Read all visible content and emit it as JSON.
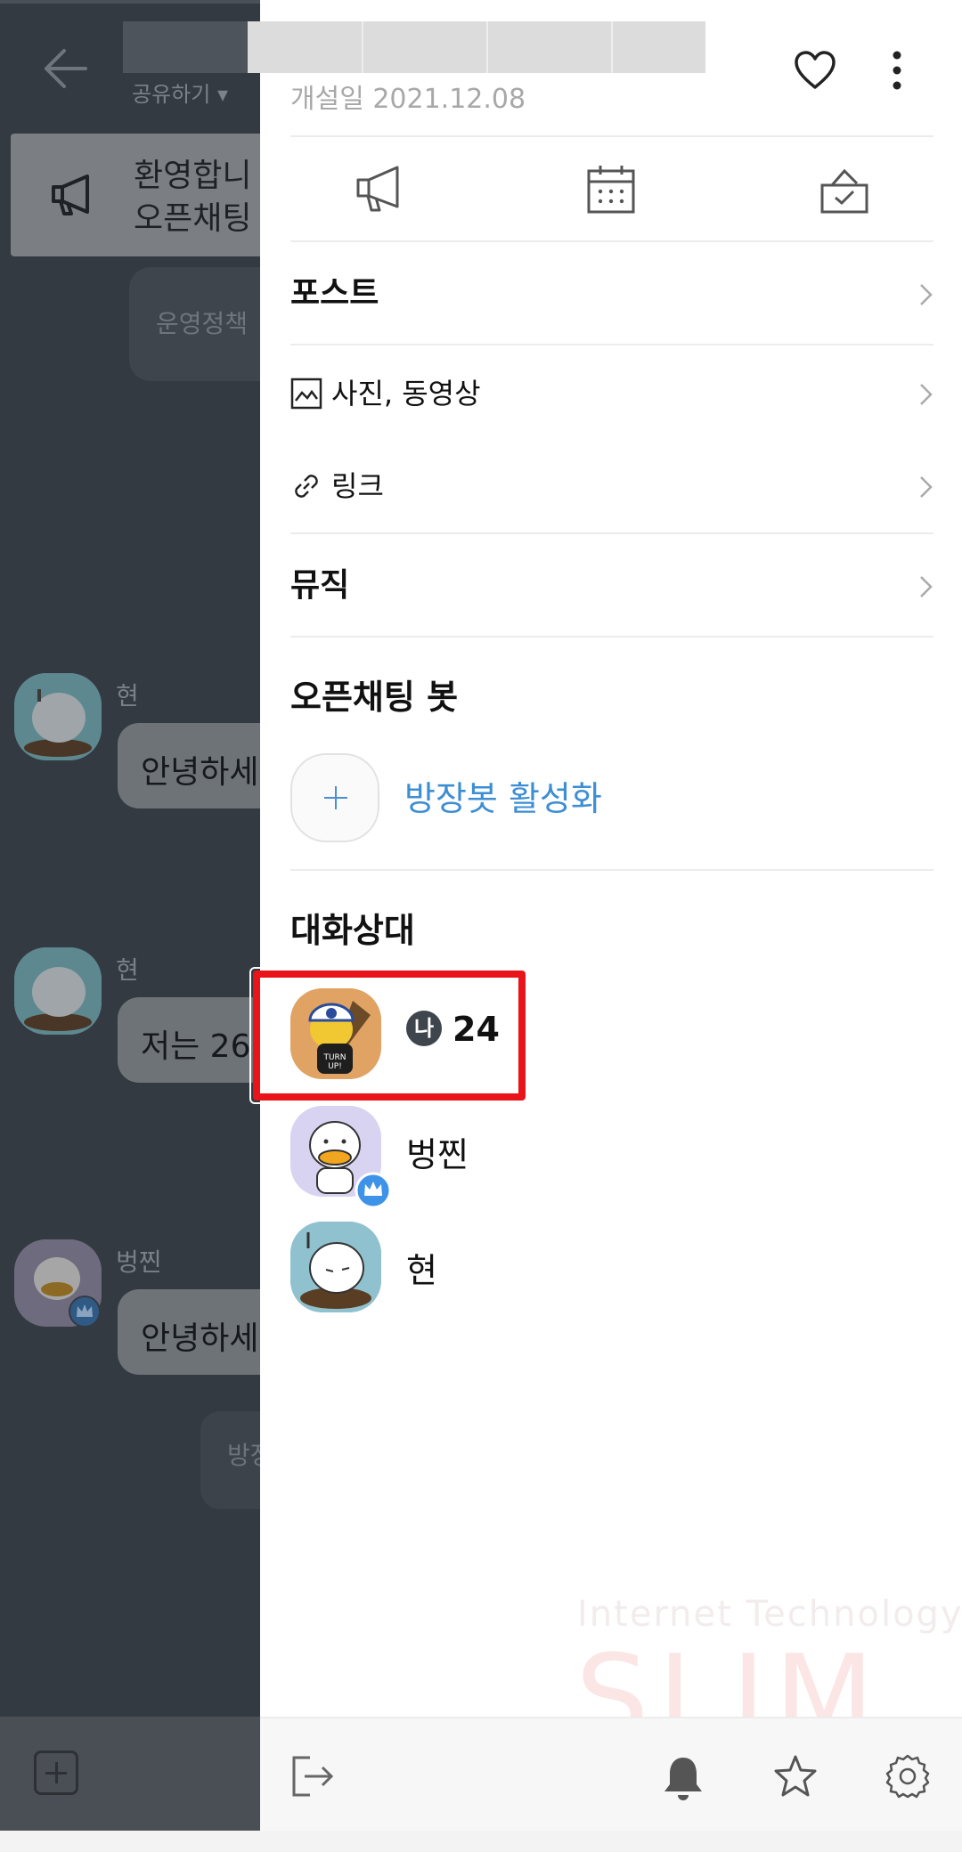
{
  "chat": {
    "share_label": "공유하기 ▾",
    "notice_line1": "환영합니",
    "notice_line2": "오픈채팅",
    "policy_text": "운영정책",
    "messages": [
      {
        "name": "현",
        "text": "안녕하세"
      },
      {
        "name": "현",
        "text": "저는 26"
      },
      {
        "name": "벙찐",
        "text": "안녕하세"
      }
    ],
    "system_text": "방장"
  },
  "drawer": {
    "opened_date": "개설일 2021.12.08",
    "tools": [
      "megaphone-icon",
      "calendar-icon",
      "vote-icon"
    ],
    "menu": {
      "post": "포스트",
      "photos_videos": "사진, 동영상",
      "links": "링크",
      "music": "뮤직"
    },
    "bot_section_title": "오픈채팅 봇",
    "bot_activate_label": "방장봇 활성화",
    "members_section_title": "대화상대",
    "members": [
      {
        "badge": "나",
        "name": "24",
        "is_me": true
      },
      {
        "name": "벙찐",
        "is_host": true
      },
      {
        "name": "현"
      }
    ],
    "watermark_small": "Internet Technology",
    "watermark_big": "SLIM"
  },
  "colors": {
    "accent_blue": "#3d8ed3",
    "highlight_red": "#e8141a",
    "host_badge": "#3e93e8"
  }
}
